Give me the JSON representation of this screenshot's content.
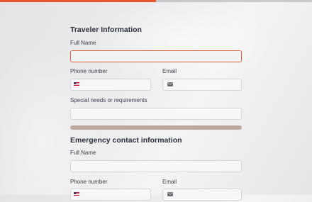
{
  "progress": {
    "fraction": 0.5,
    "fill_color": "#e4572e"
  },
  "sections": [
    {
      "title": "Traveler Information",
      "full_name": {
        "label": "Full Name",
        "value": "",
        "placeholder": ""
      },
      "phone": {
        "label": "Phone number",
        "value": "",
        "icon": "us-flag-icon"
      },
      "email": {
        "label": "Email",
        "value": "",
        "icon": "mail-icon"
      },
      "special_needs": {
        "label": "Special needs or requirements",
        "value": ""
      }
    },
    {
      "title": "Emergency contact information",
      "full_name": {
        "label": "Full Name",
        "value": ""
      },
      "phone": {
        "label": "Phone number",
        "value": "",
        "icon": "us-flag-icon"
      },
      "email": {
        "label": "Email",
        "value": "",
        "icon": "mail-icon"
      }
    }
  ],
  "colors": {
    "accent": "#e0623f",
    "divider": "#bca89e",
    "text": "#2b2f3a"
  }
}
